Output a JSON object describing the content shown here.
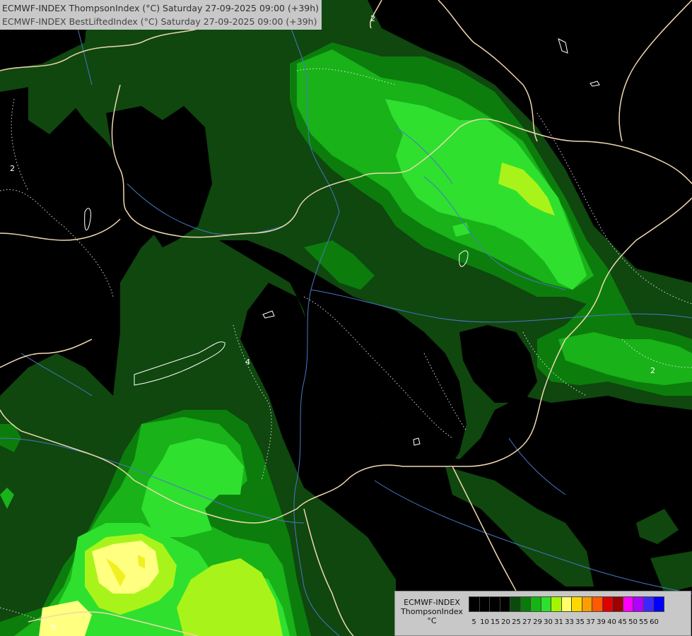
{
  "header": {
    "line1": "ECMWF-INDEX ThompsonIndex (°C) Saturday 27-09-2025 09:00 (+39h)",
    "line2": "ECMWF-INDEX BestLiftedIndex (°C) Saturday 27-09-2025 09:00 (+39h)"
  },
  "legend": {
    "line1": "ECMWF-INDEX",
    "line2": "ThompsonIndex",
    "unit": "°C",
    "ticks": [
      "5",
      "10",
      "15",
      "20",
      "25",
      "27",
      "29",
      "30",
      "31",
      "33",
      "35",
      "37",
      "39",
      "40",
      "45",
      "50",
      "55",
      "60"
    ],
    "colors": [
      "#000000",
      "#000000",
      "#000000",
      "#000000",
      "#0b4a0b",
      "#0a7a0a",
      "#14b414",
      "#2ee02e",
      "#a6f500",
      "#ffff66",
      "#ffd800",
      "#ff9c00",
      "#ff5a00",
      "#e00000",
      "#a00000",
      "#ff00ff",
      "#b000ff",
      "#3c28ff",
      "#0000ff"
    ]
  },
  "contours": {
    "labels": [
      "2",
      "4",
      "0",
      "2",
      "2"
    ]
  },
  "palette": {
    "dark_green": "#0f470f",
    "mid_green": "#0c7d0c",
    "green": "#19b219",
    "bright_green": "#2fe02f",
    "lime": "#a8f41a",
    "yellow": "#ffff80",
    "border": "#f0d8b0",
    "river": "#4a76c4"
  }
}
